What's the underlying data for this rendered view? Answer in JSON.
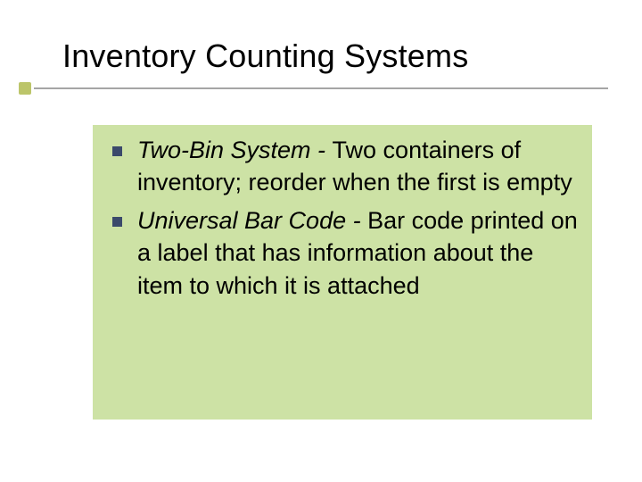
{
  "title": "Inventory Counting Systems",
  "bullets": [
    {
      "term": "Two-Bin System - ",
      "definition": "Two containers of inventory; reorder when the first is empty"
    },
    {
      "term": "Universal Bar Code - ",
      "definition": "Bar code printed on a label that has information about the item to which it is attached"
    }
  ],
  "colors": {
    "panel_bg": "#cde2a5",
    "bullet_square": "#3b4a6b",
    "rule": "#a5a5a5",
    "rule_bullet": "#bcc56a"
  }
}
